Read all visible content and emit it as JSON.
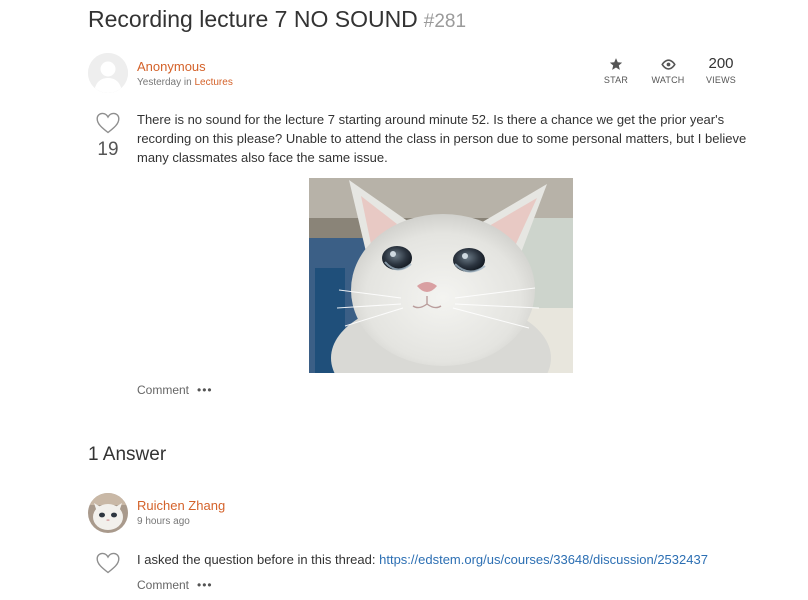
{
  "thread": {
    "title": "Recording lecture 7 NO SOUND",
    "number": "#281",
    "author": "Anonymous",
    "when": "Yesterday",
    "in_word": "in",
    "category": "Lectures",
    "stats": {
      "star_label": "STAR",
      "watch_label": "WATCH",
      "views_value": "200",
      "views_label": "VIEWS"
    },
    "like_count": "19",
    "body": "There is no sound for the lecture 7 starting around minute 52. Is there a chance we get the prior year's recording on this please? Unable to attend the class in person due to some personal matters, but I believe many classmates also face the same issue.",
    "comment_label": "Comment",
    "more_label": "•••"
  },
  "answers": {
    "heading": "1 Answer",
    "items": [
      {
        "author": "Ruichen Zhang",
        "when": "9 hours ago",
        "text_prefix": "I asked the question before in this thread: ",
        "link": "https://edstem.org/us/courses/33648/discussion/2532437",
        "comment_label": "Comment",
        "more_label": "•••"
      }
    ]
  },
  "icons": {
    "star": "star-icon",
    "watch": "eye-icon",
    "like": "heart-icon",
    "more": "more-icon"
  },
  "colors": {
    "author": "#d4622a",
    "link": "#2c6fb3"
  }
}
